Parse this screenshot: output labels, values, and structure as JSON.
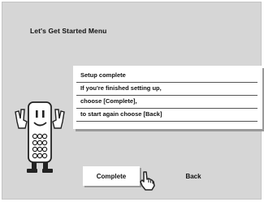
{
  "menu": {
    "title": "Let's Get Started Menu"
  },
  "message": {
    "lines": [
      "Setup complete",
      "If you're finished setting up,",
      "choose [Complete],",
      "to start again choose [Back]"
    ]
  },
  "buttons": {
    "complete_label": "Complete",
    "back_label": "Back"
  },
  "icons": {
    "mascot": "remote-control-mascot-icon",
    "cursor": "hand-pointer-icon"
  },
  "colors": {
    "background": "#d6d6d6",
    "box": "#ffffff",
    "shadow": "#9a9a9a",
    "text": "#111111"
  }
}
